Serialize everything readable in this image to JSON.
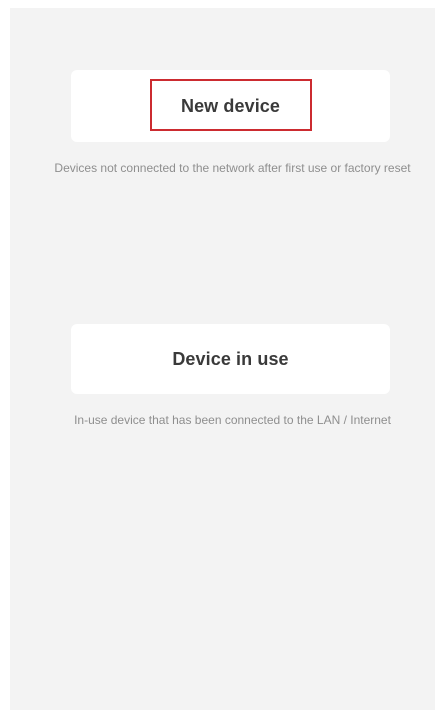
{
  "options": {
    "new_device": {
      "label": "New device",
      "description": "Devices not connected to the network after first use or factory reset"
    },
    "device_in_use": {
      "label": "Device in use",
      "description": "In-use device that has been connected to the LAN / Internet"
    }
  },
  "colors": {
    "screen_background": "#f3f3f3",
    "card_background": "#ffffff",
    "highlight_border": "#cc2b30",
    "label_text": "#3a3a3a",
    "description_text": "#8e8e8e"
  }
}
